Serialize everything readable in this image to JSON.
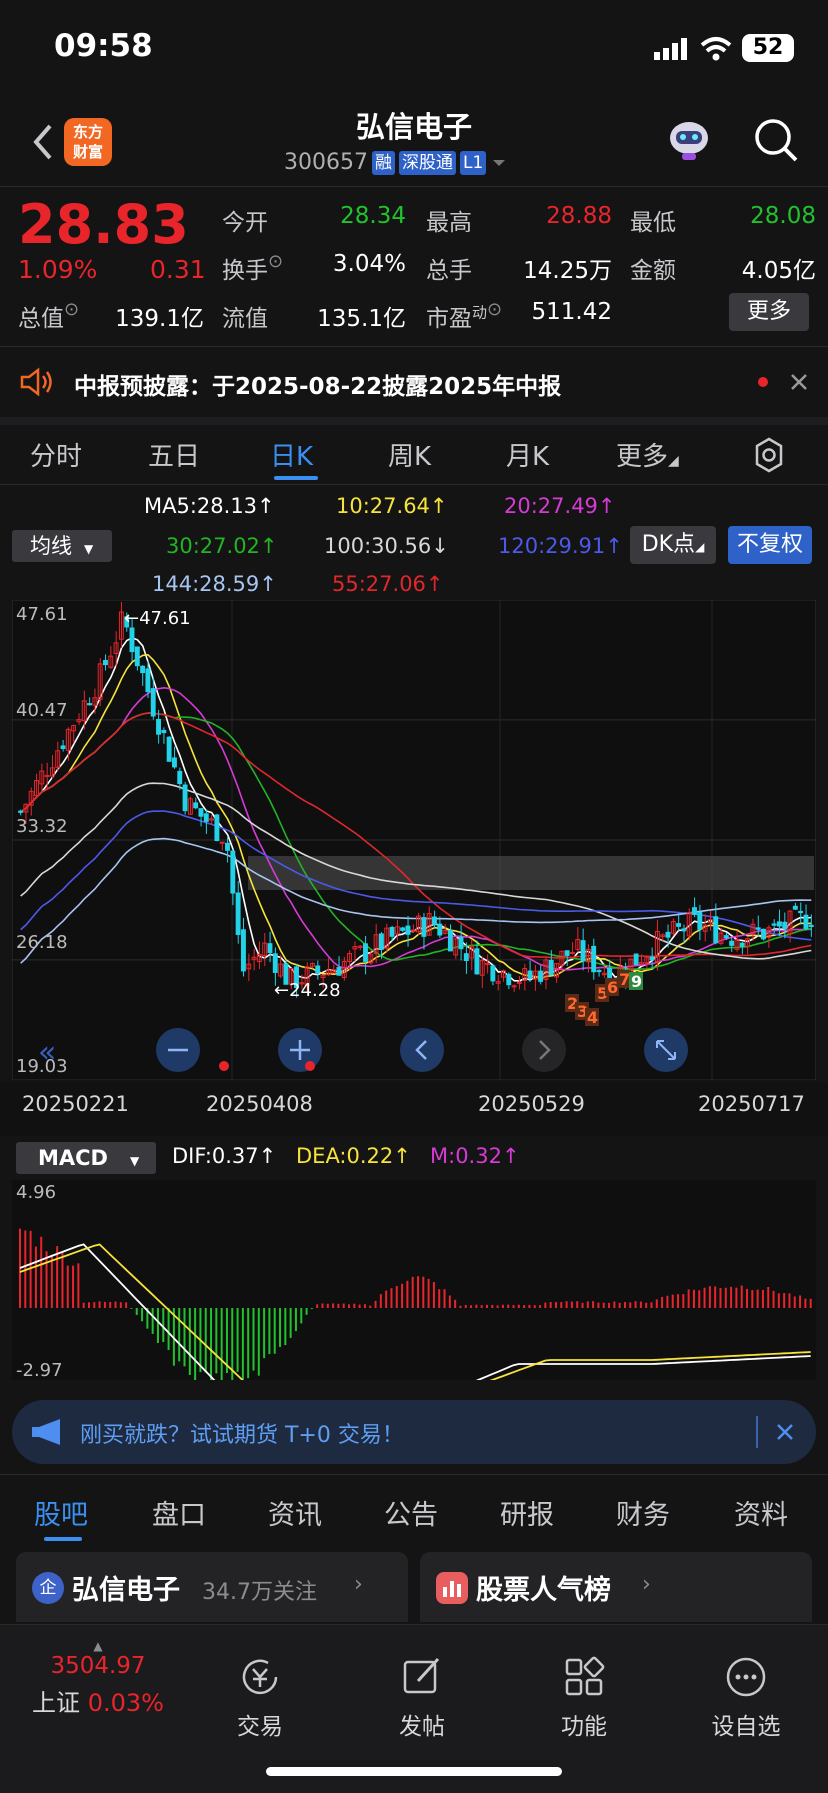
{
  "status": {
    "time": "09:58",
    "battery": "52"
  },
  "header": {
    "logo": "东方\n财富",
    "name": "弘信电子",
    "code": "300657",
    "tags": [
      "融",
      "深股通",
      "L1"
    ]
  },
  "quote": {
    "price": "28.83",
    "pct": "1.09%",
    "change": "0.31",
    "open_label": "今开",
    "open": "28.34",
    "high_label": "最高",
    "high": "28.88",
    "low_label": "最低",
    "low": "28.08",
    "turnover_label": "换手",
    "turnover": "3.04%",
    "volume_label": "总手",
    "volume": "14.25万",
    "amount_label": "金额",
    "amount": "4.05亿",
    "mcap_label": "总值",
    "mcap": "139.1亿",
    "float_label": "流值",
    "float": "135.1亿",
    "pe_label": "市盈",
    "pe_sup": "动",
    "pe": "511.42",
    "more": "更多"
  },
  "notice": {
    "text": "中报预披露：于2025-08-22披露2025年中报"
  },
  "period_tabs": [
    "分时",
    "五日",
    "日K",
    "周K",
    "月K",
    "更多"
  ],
  "ma": {
    "selector": "均线",
    "ma5": "MA5:28.13",
    "ma10": "10:27.64",
    "ma20": "20:27.49",
    "ma30": "30:27.02",
    "ma100": "100:30.56",
    "ma120": "120:29.91",
    "ma144": "144:28.59",
    "ma55": "55:27.06",
    "dk": "DK点",
    "fuquan": "不复权",
    "colors": {
      "ma5": "#ffffff",
      "ma10": "#f7e43b",
      "ma20": "#d63bd6",
      "ma30": "#22b422",
      "ma100": "#d8d8d8",
      "ma120": "#4b5ae8",
      "ma144": "#a8c4f0",
      "ma55": "#e0282b"
    }
  },
  "kchart": {
    "y_labels": [
      "47.61",
      "40.47",
      "33.32",
      "26.18",
      "19.03"
    ],
    "max_label": "47.61",
    "min_label": "24.28",
    "dates": [
      "20250221",
      "20250408",
      "20250529",
      "20250717"
    ]
  },
  "macd": {
    "selector": "MACD",
    "dif": "DIF:0.37",
    "dea": "DEA:0.22",
    "m": "M:0.32",
    "y_top": "4.96",
    "y_bottom": "-2.97"
  },
  "chart_data": {
    "type": "candlestick",
    "ylim": [
      19.03,
      47.61
    ],
    "max_point": 47.61,
    "min_point": 24.28,
    "last_close": 28.83,
    "x_ticks": [
      "20250221",
      "20250408",
      "20250529",
      "20250717"
    ]
  },
  "banner": {
    "text": "刚买就跌？试试期货 T+0 交易！"
  },
  "bottom_tabs": [
    "股吧",
    "盘口",
    "资讯",
    "公告",
    "研报",
    "财务",
    "资料"
  ],
  "cards": {
    "left_title": "弘信电子",
    "left_sub": "34.7万关注",
    "right_title": "股票人气榜"
  },
  "navbar": {
    "index_value": "3504.97",
    "index_name": "上证",
    "index_pct": "0.03%",
    "items": [
      "交易",
      "发帖",
      "功能",
      "设自选"
    ]
  }
}
